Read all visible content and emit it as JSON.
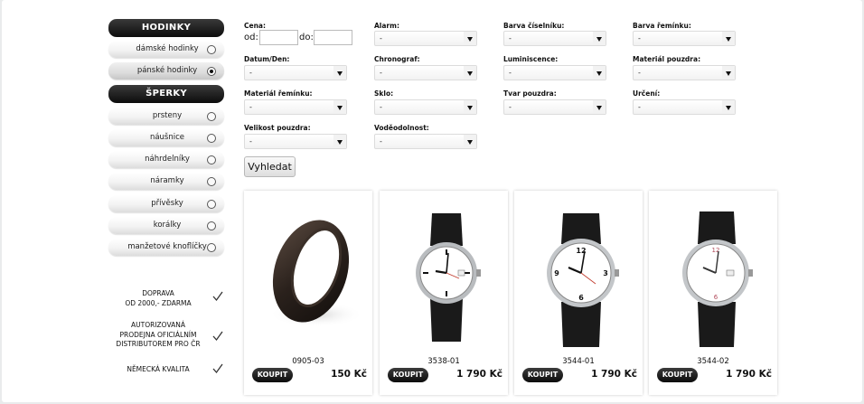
{
  "sidebar": {
    "watches_header": "HODINKY",
    "watches": [
      {
        "label": "dámské hodinky",
        "selected": false
      },
      {
        "label": "pánské hodinky",
        "selected": true
      }
    ],
    "jewelry_header": "ŠPERKY",
    "jewelry": [
      {
        "label": "prsteny"
      },
      {
        "label": "náušnice"
      },
      {
        "label": "náhrdelníky"
      },
      {
        "label": "náramky"
      },
      {
        "label": "přívěsky"
      },
      {
        "label": "korálky"
      },
      {
        "label": "manžetové knoflíčky"
      }
    ],
    "benefits": [
      {
        "line1": "DOPRAVA",
        "line2": "OD 2000,- ZDARMA",
        "line3": ""
      },
      {
        "line1": "AUTORIZOVANÁ",
        "line2": "PRODEJNA OFICIÁLNÍM",
        "line3": "DISTRIBUTOREM PRO ČR"
      },
      {
        "line1": "NĚMECKÁ KVALITA",
        "line2": "",
        "line3": ""
      }
    ]
  },
  "filters": {
    "price": {
      "label": "Cena:",
      "from_label": "od:",
      "to_label": "do:",
      "from_value": "",
      "to_value": ""
    },
    "alarm": {
      "label": "Alarm:",
      "value": "-"
    },
    "dial_color": {
      "label": "Barva číselníku:",
      "value": "-"
    },
    "strap_color": {
      "label": "Barva řemínku:",
      "value": "-"
    },
    "date_day": {
      "label": "Datum/Den:",
      "value": "-"
    },
    "chronograph": {
      "label": "Chronograf:",
      "value": "-"
    },
    "luminescence": {
      "label": "Luminiscence:",
      "value": "-"
    },
    "case_material": {
      "label": "Materiál pouzdra:",
      "value": "-"
    },
    "strap_material": {
      "label": "Materiál řemínku:",
      "value": "-"
    },
    "glass": {
      "label": "Sklo:",
      "value": "-"
    },
    "case_shape": {
      "label": "Tvar pouzdra:",
      "value": "-"
    },
    "purpose": {
      "label": "Určení:",
      "value": "-"
    },
    "case_size": {
      "label": "Velikost pouzdra:",
      "value": "-"
    },
    "water_resistance": {
      "label": "Voděodolnost:",
      "value": "-"
    },
    "search_button": "Vyhledat"
  },
  "products": [
    {
      "code": "0905-03",
      "buy_label": "KOUPIT",
      "price": "150 Kč",
      "image": "black-ring"
    },
    {
      "code": "3538-01",
      "buy_label": "KOUPIT",
      "price": "1 790 Kč",
      "image": "watch"
    },
    {
      "code": "3544-01",
      "buy_label": "KOUPIT",
      "price": "1 790 Kč",
      "image": "watch"
    },
    {
      "code": "3544-02",
      "buy_label": "KOUPIT",
      "price": "1 790 Kč",
      "image": "watch"
    }
  ],
  "colors": {
    "accent": "#111111",
    "background": "#e9ebec"
  }
}
